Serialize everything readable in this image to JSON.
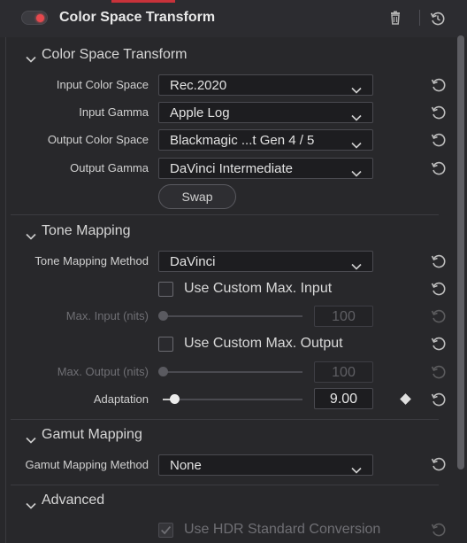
{
  "header": {
    "title": "Color Space Transform",
    "toggle_on": true
  },
  "sections": {
    "cst": "Color Space Transform",
    "tone": "Tone Mapping",
    "gamut": "Gamut Mapping",
    "advanced": "Advanced"
  },
  "cst": {
    "input_color_space": {
      "label": "Input Color Space",
      "value": "Rec.2020"
    },
    "input_gamma": {
      "label": "Input Gamma",
      "value": "Apple Log"
    },
    "output_color_space": {
      "label": "Output Color Space",
      "value": "Blackmagic ...t Gen 4 / 5"
    },
    "output_gamma": {
      "label": "Output Gamma",
      "value": "DaVinci Intermediate"
    },
    "swap_label": "Swap"
  },
  "tone": {
    "method": {
      "label": "Tone Mapping Method",
      "value": "DaVinci"
    },
    "use_custom_max_input": {
      "label": "Use Custom Max. Input",
      "checked": false
    },
    "max_input": {
      "label": "Max. Input (nits)",
      "value": "100",
      "enabled": false
    },
    "use_custom_max_output": {
      "label": "Use Custom Max. Output",
      "checked": false
    },
    "max_output": {
      "label": "Max. Output (nits)",
      "value": "100",
      "enabled": false
    },
    "adaptation": {
      "label": "Adaptation",
      "value": "9.00"
    }
  },
  "gamut": {
    "method": {
      "label": "Gamut Mapping Method",
      "value": "None"
    }
  },
  "advanced": {
    "use_hdr_standard_conversion": {
      "label": "Use HDR Standard Conversion",
      "checked": true,
      "enabled": false
    }
  },
  "colors": {
    "accent": "#c8323a",
    "toggle_dot": "#e5484d",
    "panel_bg": "#28282b",
    "field_bg": "#1d1d20"
  },
  "icons": {
    "trash": "trash-icon",
    "reset": "reset-icon",
    "chevron": "chevron-down-icon",
    "keyframe": "keyframe-diamond-icon"
  }
}
